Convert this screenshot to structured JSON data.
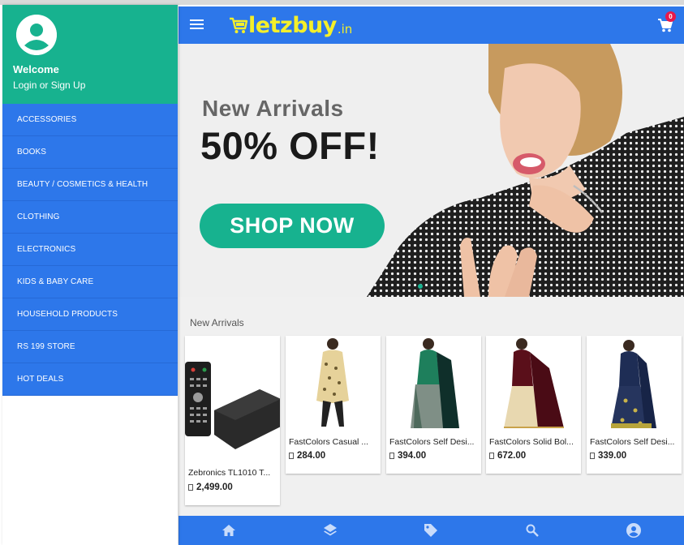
{
  "drawer": {
    "welcome": "Welcome",
    "login": "Login or Sign Up",
    "items": [
      {
        "label": "ACCESSORIES"
      },
      {
        "label": "BOOKS"
      },
      {
        "label": "BEAUTY / COSMETICS & HEALTH"
      },
      {
        "label": "CLOTHING"
      },
      {
        "label": "ELECTRONICS"
      },
      {
        "label": "KIDS & BABY CARE"
      },
      {
        "label": "HOUSEHOLD PRODUCTS"
      },
      {
        "label": "RS 199 STORE"
      },
      {
        "label": "HOT DEALS"
      }
    ]
  },
  "header": {
    "logo_main": "letzbuy",
    "logo_suffix": ".in",
    "cart_count": "0"
  },
  "banner": {
    "subtitle": "New Arrivals",
    "headline": "50% OFF!",
    "cta": "SHOP NOW"
  },
  "products": {
    "section_title": "New Arrivals",
    "items": [
      {
        "name": "Zebronics TL1010 T...",
        "price": "2,499.00"
      },
      {
        "name": "FastColors Casual ...",
        "price": "284.00"
      },
      {
        "name": "FastColors Self Desi...",
        "price": "394.00"
      },
      {
        "name": "FastColors Solid Bol...",
        "price": "672.00"
      },
      {
        "name": "FastColors Self Desi...",
        "price": "339.00"
      }
    ]
  },
  "colors": {
    "primary": "#2d77ea",
    "accent": "#17b28f",
    "badge": "#e8194a",
    "logo": "#f4ef2a"
  },
  "icons": {
    "bottom_nav": [
      "home-icon",
      "layers-icon",
      "tag-icon",
      "search-icon",
      "account-icon"
    ]
  }
}
